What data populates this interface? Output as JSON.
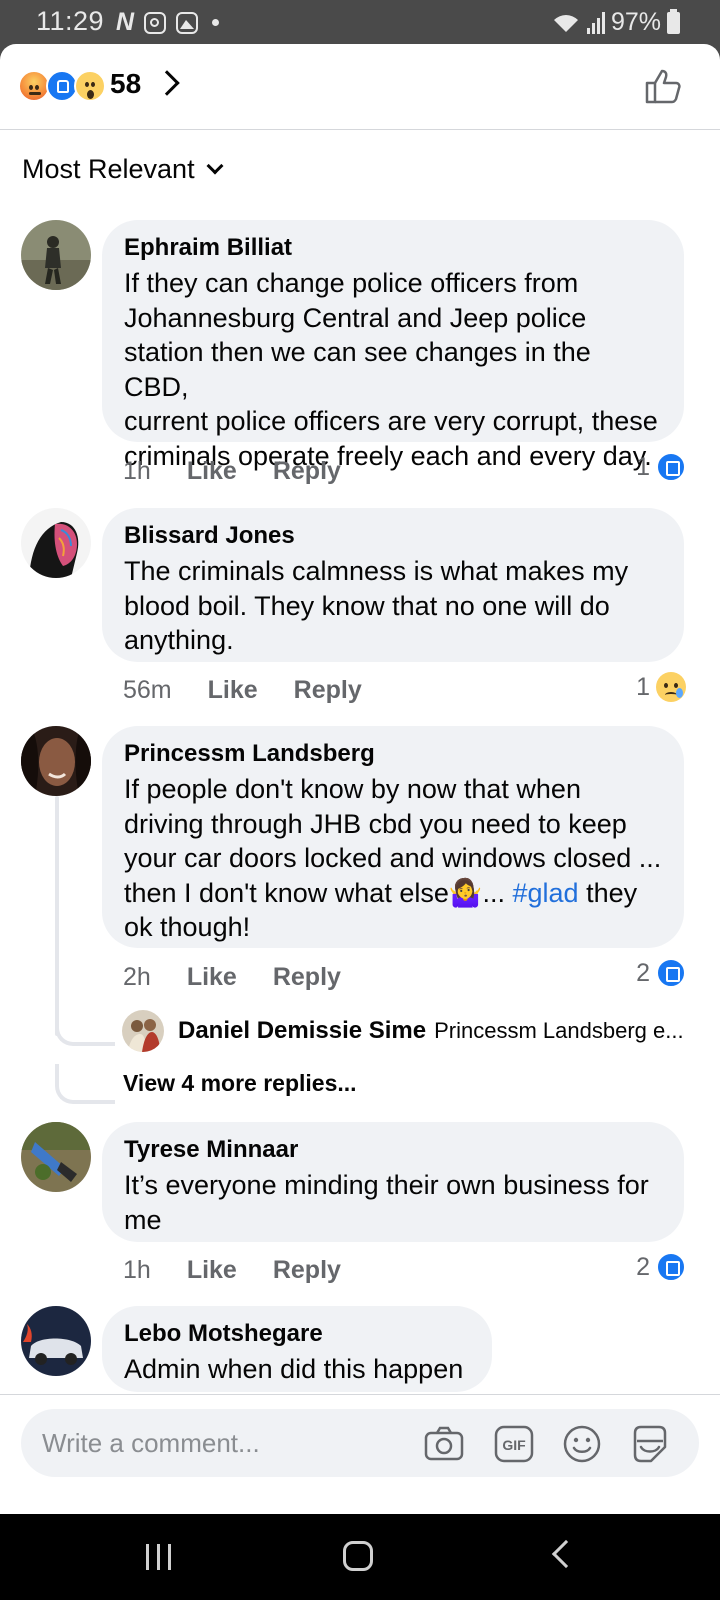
{
  "status_bar": {
    "time": "11:29",
    "battery": "97%"
  },
  "reactions": {
    "types": [
      "angry",
      "like",
      "wow"
    ],
    "count": "58"
  },
  "sort": {
    "label": "Most Relevant"
  },
  "comments": [
    {
      "name": "Ephraim Billiat",
      "text": "If they can change police officers from\nJohannesburg Central and Jeep police\nstation then we can see changes in the CBD,\ncurrent police officers are very corrupt, these\ncriminals operate freely each and every day.",
      "time": "1h",
      "like": "Like",
      "reply": "Reply",
      "reaction_count": "1",
      "reaction_type": "like"
    },
    {
      "name": "Blissard Jones",
      "text": "The criminals calmness is what makes my\nblood boil. They know that no one will do\nanything.",
      "time": "56m",
      "like": "Like",
      "reply": "Reply",
      "reaction_count": "1",
      "reaction_type": "sad"
    },
    {
      "name": "Princessm Landsberg",
      "text_before": "If people don't know by now that when\ndriving through JHB cbd you need to keep\nyour car doors locked and windows closed ...\nthen I don't know what else",
      "emoji": "🤷‍♀️",
      "text_mid": "... ",
      "hashtag": "#glad",
      "text_after": " they\nok though!",
      "time": "2h",
      "like": "Like",
      "reply": "Reply",
      "reaction_count": "2",
      "reaction_type": "like",
      "reply_preview": {
        "name": "Daniel Demissie Sime",
        "snippet": "Princessm Landsberg e..."
      },
      "view_more": "View 4 more replies..."
    },
    {
      "name": "Tyrese Minnaar",
      "text": "It’s everyone minding their own business for\nme",
      "time": "1h",
      "like": "Like",
      "reply": "Reply",
      "reaction_count": "2",
      "reaction_type": "like"
    },
    {
      "name": "Lebo Motshegare",
      "text": "Admin when did this happen"
    }
  ],
  "composer": {
    "placeholder": "Write a comment..."
  },
  "icons": {
    "header": "thumbs-up-icon",
    "composer": [
      "camera-icon",
      "gif-icon",
      "emoji-icon",
      "sticker-icon"
    ],
    "nav": [
      "recents-icon",
      "home-icon",
      "back-icon"
    ]
  },
  "colors": {
    "accent": "#1877f2",
    "bubble": "#f0f2f5",
    "hashtag": "#216fdb",
    "muted_text": "#65676b"
  }
}
